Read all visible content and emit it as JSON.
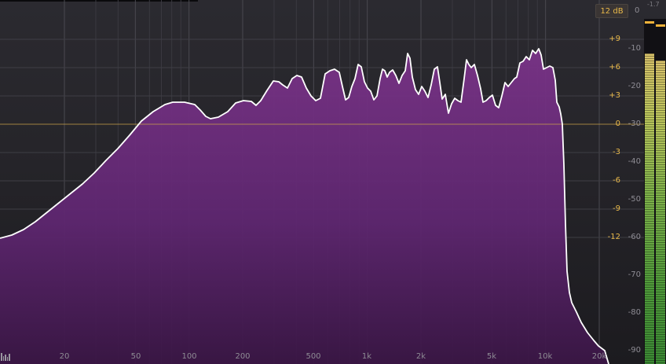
{
  "range_button": {
    "label": "12 dB"
  },
  "meter": {
    "zero_label": "0",
    "peak_readout": "-1.7",
    "left_level": 0.9,
    "right_level": 0.88
  },
  "freq_labels": [
    "20",
    "50",
    "100",
    "200",
    "500",
    "1k",
    "2k",
    "5k",
    "10k",
    "20k"
  ],
  "gain_labels": [
    "+9",
    "+6",
    "+3",
    "0",
    "-3",
    "-6",
    "-9",
    "-12"
  ],
  "db_labels": [
    "-10",
    "-20",
    "-30",
    "-40",
    "-50",
    "-60",
    "-70",
    "-80",
    "-90"
  ],
  "colors": {
    "fill_top": "#7a3388",
    "fill_bottom": "#3a1645",
    "curve": "#ffffff",
    "accent": "#e9b94a",
    "grid": "#4a4950"
  },
  "icons": {
    "settings": "spectrum-settings-icon"
  }
}
